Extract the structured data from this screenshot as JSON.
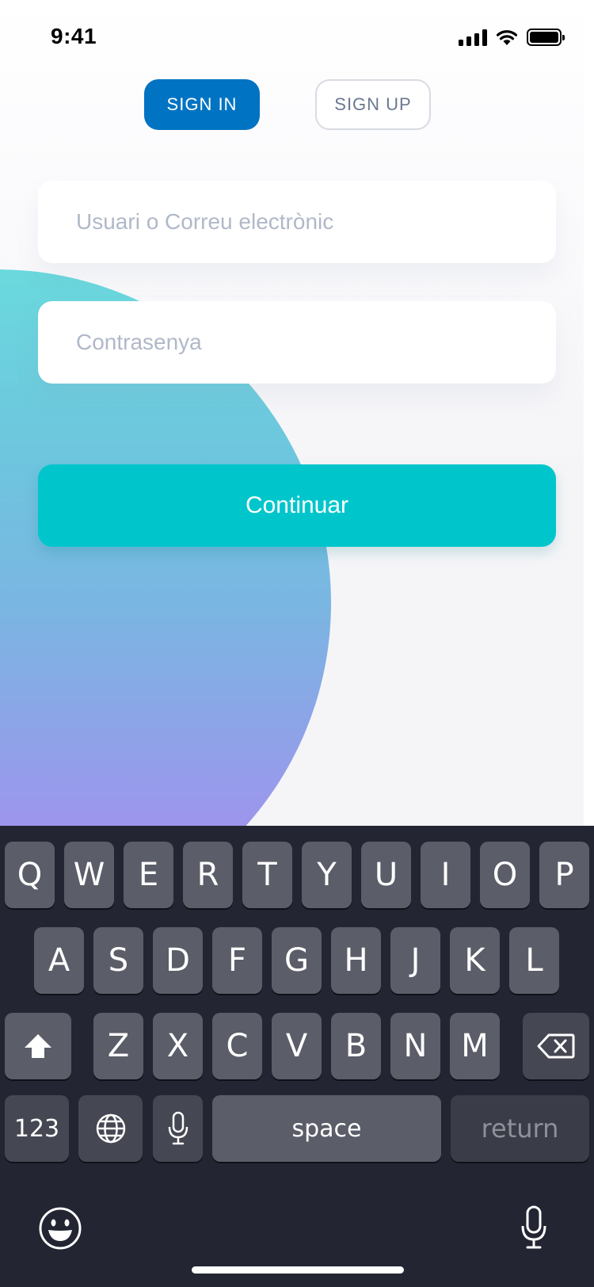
{
  "status_bar": {
    "time": "9:41",
    "icons": [
      "cellular-signal-icon",
      "wifi-icon",
      "battery-icon"
    ]
  },
  "tabs": [
    {
      "label": "SIGN IN",
      "active": true
    },
    {
      "label": "SIGN UP",
      "active": false
    }
  ],
  "form": {
    "username": {
      "placeholder": "Usuari o Correu electrònic",
      "value": ""
    },
    "password": {
      "placeholder": "Contrasenya",
      "value": ""
    },
    "continue_label": "Continuar"
  },
  "keyboard": {
    "row1": [
      "Q",
      "W",
      "E",
      "R",
      "T",
      "Y",
      "U",
      "I",
      "O",
      "P"
    ],
    "row2": [
      "A",
      "S",
      "D",
      "F",
      "G",
      "H",
      "J",
      "K",
      "L"
    ],
    "row3": [
      "Z",
      "X",
      "C",
      "V",
      "B",
      "N",
      "M"
    ],
    "numbers_label": "123",
    "space_label": "space",
    "return_label": "return",
    "icons": [
      "shift-icon",
      "backspace-icon",
      "globe-icon",
      "microphone-icon",
      "emoji-icon",
      "dictation-icon"
    ]
  },
  "colors": {
    "primary": "#0073c2",
    "accent": "#00c6cc",
    "keyboard_bg": "#232533"
  }
}
